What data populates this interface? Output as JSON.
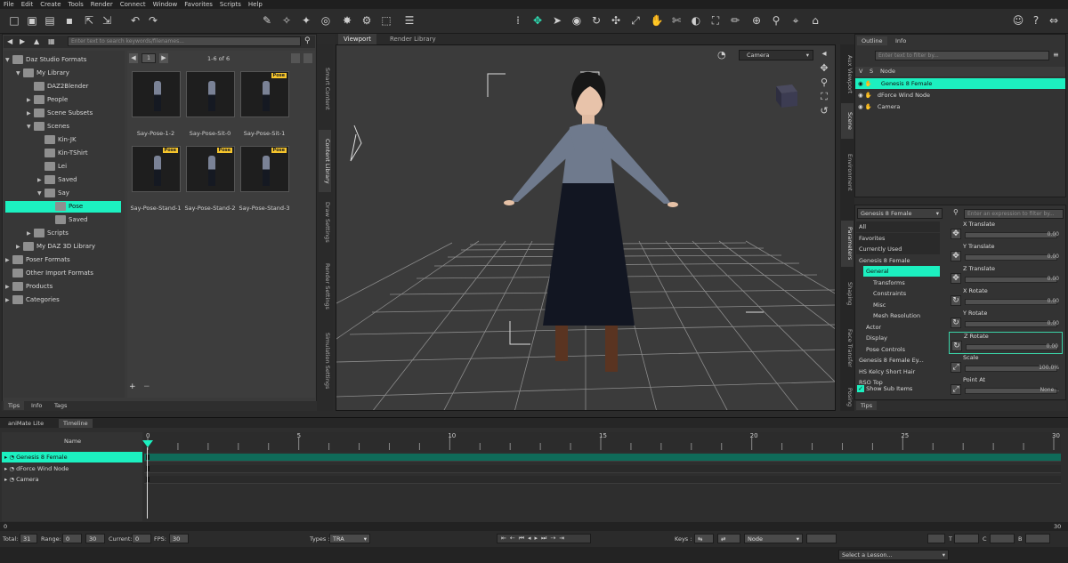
{
  "menu": [
    "File",
    "Edit",
    "Create",
    "Tools",
    "Render",
    "Connect",
    "Window",
    "Favorites",
    "Scripts",
    "Help"
  ],
  "left": {
    "search_placeholder": "Enter text to search keywords/filenames...",
    "page_label": "1",
    "page_count": "1-6 of 6",
    "tree": [
      {
        "label": "Daz Studio Formats",
        "indent": 0,
        "arrow": "▼"
      },
      {
        "label": "My Library",
        "indent": 1,
        "arrow": "▼"
      },
      {
        "label": "DAZ2Blender",
        "indent": 2,
        "arrow": ""
      },
      {
        "label": "People",
        "indent": 2,
        "arrow": "▶"
      },
      {
        "label": "Scene Subsets",
        "indent": 2,
        "arrow": "▶"
      },
      {
        "label": "Scenes",
        "indent": 2,
        "arrow": "▼"
      },
      {
        "label": "Kin-JK",
        "indent": 3,
        "arrow": ""
      },
      {
        "label": "Kin-TShirt",
        "indent": 3,
        "arrow": ""
      },
      {
        "label": "Lei",
        "indent": 3,
        "arrow": ""
      },
      {
        "label": "Saved",
        "indent": 3,
        "arrow": "▶"
      },
      {
        "label": "Say",
        "indent": 3,
        "arrow": "▼"
      },
      {
        "label": "Pose",
        "indent": 4,
        "arrow": "",
        "selected": true
      },
      {
        "label": "Saved",
        "indent": 4,
        "arrow": ""
      },
      {
        "label": "Scripts",
        "indent": 2,
        "arrow": "▶"
      },
      {
        "label": "My DAZ 3D Library",
        "indent": 1,
        "arrow": "▶"
      },
      {
        "label": "Poser Formats",
        "indent": 0,
        "arrow": "▶"
      },
      {
        "label": "Other Import Formats",
        "indent": 0,
        "arrow": ""
      },
      {
        "label": "Products",
        "indent": 0,
        "arrow": "▶"
      },
      {
        "label": "Categories",
        "indent": 0,
        "arrow": "▶"
      }
    ],
    "thumbnails": [
      {
        "label": "Say-Pose-1-2",
        "badge": ""
      },
      {
        "label": "Say-Pose-Sit-0",
        "badge": ""
      },
      {
        "label": "Say-Pose-Sit-1",
        "badge": "Pose"
      },
      {
        "label": "Say-Pose-Stand-1",
        "badge": "Pose"
      },
      {
        "label": "Say-Pose-Stand-2",
        "badge": "Pose"
      },
      {
        "label": "Say-Pose-Stand-3",
        "badge": "Pose"
      }
    ],
    "side_tabs": [
      "Smart Content",
      "Content Library",
      "Draw Settings",
      "Render Settings",
      "Simulation Settings"
    ],
    "bottom_tabs": [
      "Tips",
      "Info",
      "Tags"
    ]
  },
  "viewport": {
    "tabs": [
      "Viewport",
      "Render Library"
    ],
    "camera": "Camera"
  },
  "scene": {
    "tabs": [
      "Outline",
      "Info"
    ],
    "filter_placeholder": "Enter text to filter by...",
    "columns": [
      "V",
      "S",
      "Node"
    ],
    "nodes": [
      {
        "label": "Genesis 8 Female",
        "selected": true
      },
      {
        "label": "dForce Wind Node",
        "selected": false
      },
      {
        "label": "Camera",
        "selected": false
      }
    ],
    "right_vtabs": [
      "Aux Viewport",
      "Scene",
      "Environment",
      "Parameters",
      "Shaping",
      "Face Transfer",
      "Posing"
    ]
  },
  "parameters": {
    "node_select": "Genesis 8 Female",
    "filter_placeholder": "Enter an expression to filter by...",
    "groups": [
      {
        "label": "All"
      },
      {
        "label": "Favorites"
      },
      {
        "label": "Currently Used"
      },
      {
        "label": "Genesis 8 Female"
      },
      {
        "label": "General",
        "selected": true
      },
      {
        "label": "Transforms"
      },
      {
        "label": "Constraints"
      },
      {
        "label": "Misc"
      },
      {
        "label": "Mesh Resolution"
      },
      {
        "label": "Actor"
      },
      {
        "label": "Display"
      },
      {
        "label": "Pose Controls"
      },
      {
        "label": "Genesis 8 Female Ey..."
      },
      {
        "label": "HS Kelcy Short Hair"
      },
      {
        "label": "RSO Top"
      }
    ],
    "properties": [
      {
        "label": "X Translate",
        "value": "0.00"
      },
      {
        "label": "Y Translate",
        "value": "0.00"
      },
      {
        "label": "Z Translate",
        "value": "0.00"
      },
      {
        "label": "X Rotate",
        "value": "0.00"
      },
      {
        "label": "Y Rotate",
        "value": "0.00"
      },
      {
        "label": "Z Rotate",
        "value": "0.00"
      },
      {
        "label": "Scale",
        "value": "100.0%"
      },
      {
        "label": "Point At",
        "value": "None..."
      }
    ],
    "show_sub_items": "Show Sub Items",
    "bottom_tab": "Tips"
  },
  "timeline": {
    "tabs": [
      "aniMate Lite",
      "Timeline"
    ],
    "name_header": "Name",
    "tracks": [
      {
        "label": "Genesis 8 Female",
        "selected": true
      },
      {
        "label": "dForce Wind Node",
        "selected": false
      },
      {
        "label": "Camera",
        "selected": false
      }
    ],
    "ruler_ticks": [
      "0",
      "5",
      "10",
      "15",
      "20",
      "25",
      "30"
    ],
    "scrub_start": "0",
    "scrub_end": "30"
  },
  "status": {
    "total_label": "Total:",
    "total": "31",
    "range_label": "Range:",
    "range_start": "0",
    "range_end": "30",
    "current_label": "Current:",
    "current": "0",
    "fps_label": "FPS:",
    "fps": "30",
    "types_label": "Types :",
    "types": "TRA",
    "keys_label": "Keys :",
    "keys_node": "Node",
    "t_label": "T",
    "c_label": "C",
    "b_label": "B",
    "lesson": "Select a Lesson..."
  },
  "colors": {
    "accent": "#1cf0c0",
    "panel": "#3a3a3a",
    "dark": "#2b2b2b"
  }
}
